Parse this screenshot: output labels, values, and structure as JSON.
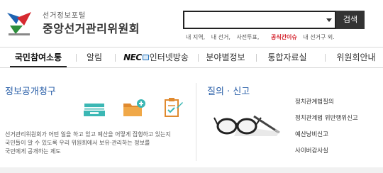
{
  "header": {
    "brand_sub": "선거정보포털",
    "brand_main": "중앙선거관리위원회",
    "search": {
      "value": "",
      "placeholder": "",
      "button_label": "검색"
    },
    "keywords": [
      "내 지역,",
      "내 선거,",
      "사전투표,"
    ],
    "keywords_highlight": "공식간이슈",
    "keywords_tail": "내 선거구 외."
  },
  "nav": {
    "items": [
      {
        "label": "국민참여소통"
      },
      {
        "label": "알림"
      },
      {
        "label_brand": "NEC",
        "label": "인터넷방송"
      },
      {
        "label": "분야별정보"
      },
      {
        "label": "통합자료실"
      },
      {
        "label": "위원회안내"
      }
    ]
  },
  "left_section": {
    "title": "정보공개청구",
    "description_lines": [
      "선거관리위원회가 어떤 일을 하고 있고 예산을 어떻게 집행하고 있는지",
      "국민들이 알 수 있도록 우리 위원회에서 보유·관리하는 정보를",
      "국민에게 공개하는 제도"
    ]
  },
  "right_section": {
    "title": "질의 · 신고",
    "links": [
      "정치관계법질의",
      "정치관계법 위반행위신고",
      "예산낭비신고",
      "사이버감사실"
    ]
  },
  "colors": {
    "accent_blue": "#2a5fa8",
    "highlight_red": "#d3202a",
    "teal_icon": "#3bb7b4",
    "orange_icon": "#e08a2f",
    "search_border": "#222222"
  }
}
